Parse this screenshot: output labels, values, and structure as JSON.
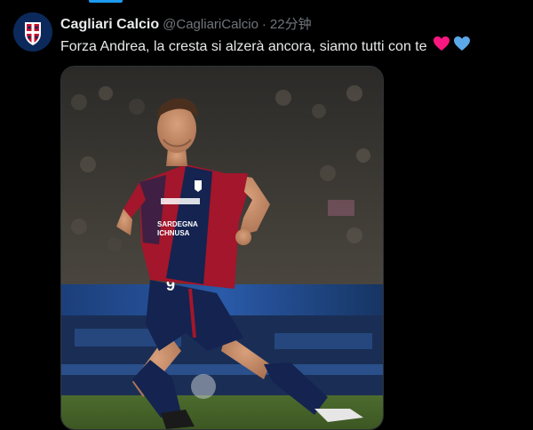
{
  "account": {
    "name": "Cagliari Calcio",
    "handle": "@CagliariCalcio",
    "separator": "·",
    "time": "22分钟"
  },
  "tweet": {
    "text": "Forza Andrea, la cresta si alzerà ancora, siamo tutti con te",
    "emojis": [
      "red-heart",
      "blue-heart"
    ]
  },
  "photo": {
    "jersey_sponsor": "SARDEGNA",
    "jersey_sponsor_2": "ICHNUSA",
    "shirt_number": "9"
  },
  "colors": {
    "background": "#000000",
    "text_primary": "#e7e9ea",
    "text_secondary": "#71767b",
    "accent": "#1d9bf0",
    "heart_red": "#f91880",
    "heart_blue": "#5ba7e8",
    "club_red": "#a3162b",
    "club_blue": "#14234f"
  }
}
